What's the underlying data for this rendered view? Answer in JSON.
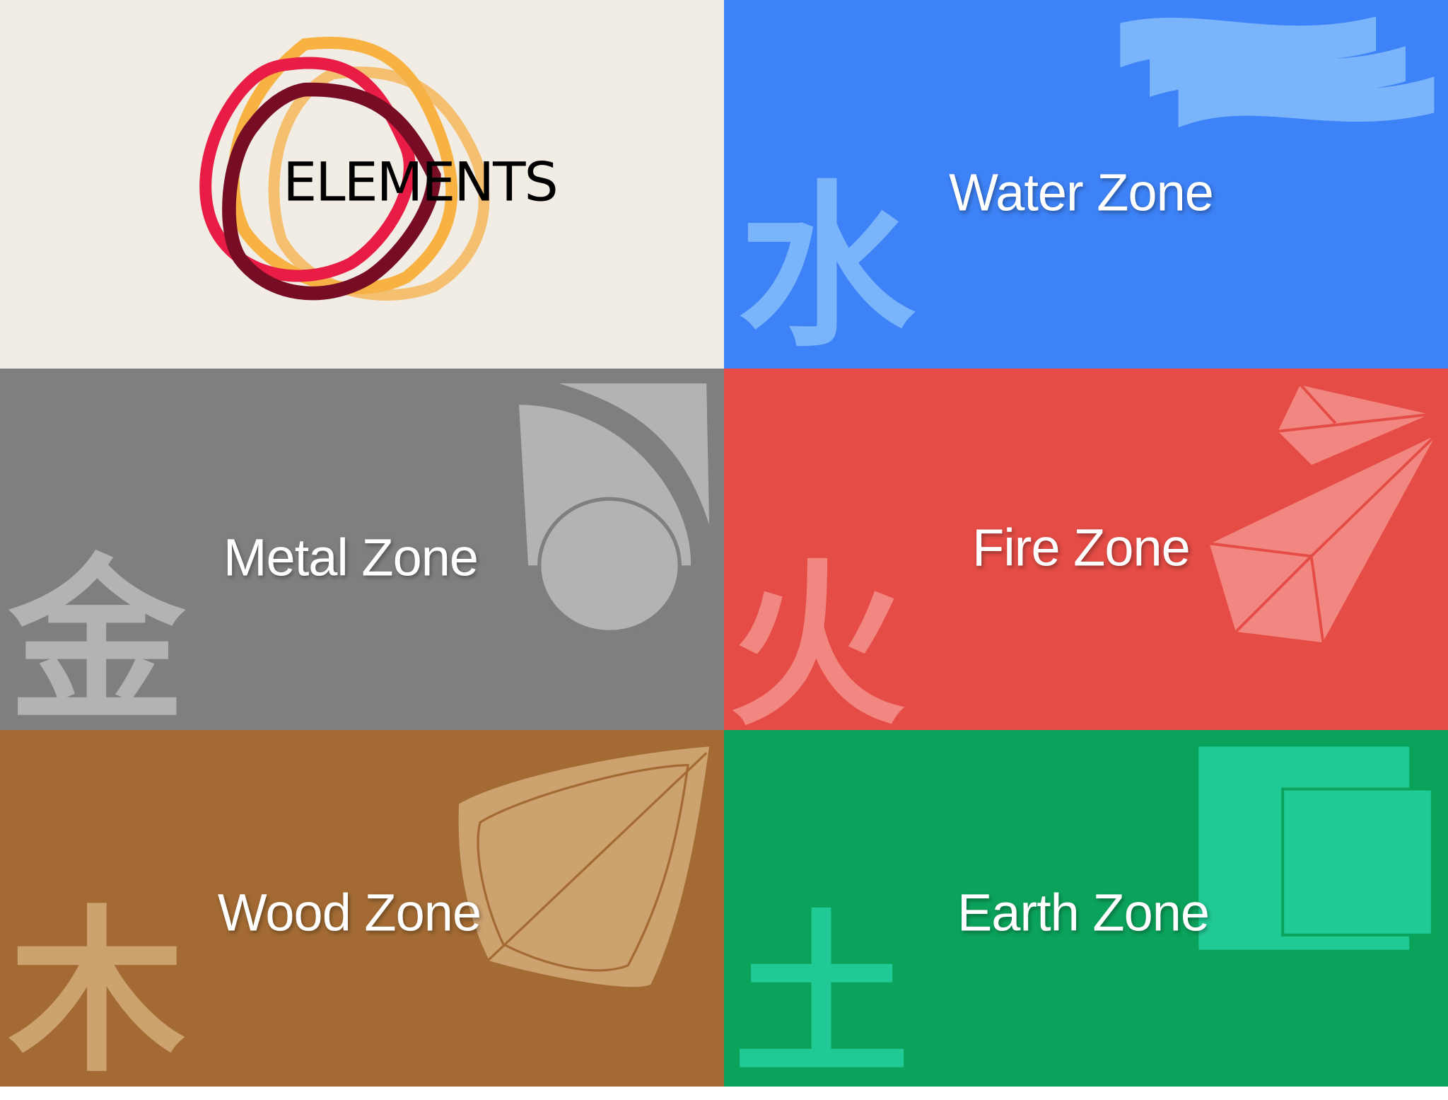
{
  "logo": {
    "text": "ELEMENTS"
  },
  "zones": {
    "water": {
      "label": "Water Zone",
      "glyph": "水",
      "color": "#3d82f6",
      "accent": "#7ab4fb"
    },
    "metal": {
      "label": "Metal Zone",
      "glyph": "金",
      "color": "#7f7f7f",
      "accent": "#b3b3b3"
    },
    "fire": {
      "label": "Fire Zone",
      "glyph": "火",
      "color": "#e44c45",
      "accent": "#f28680"
    },
    "wood": {
      "label": "Wood Zone",
      "glyph": "木",
      "color": "#a36b33",
      "accent": "#cca26f"
    },
    "earth": {
      "label": "Earth Zone",
      "glyph": "土",
      "color": "#0ba35b",
      "accent": "#21c994"
    }
  }
}
